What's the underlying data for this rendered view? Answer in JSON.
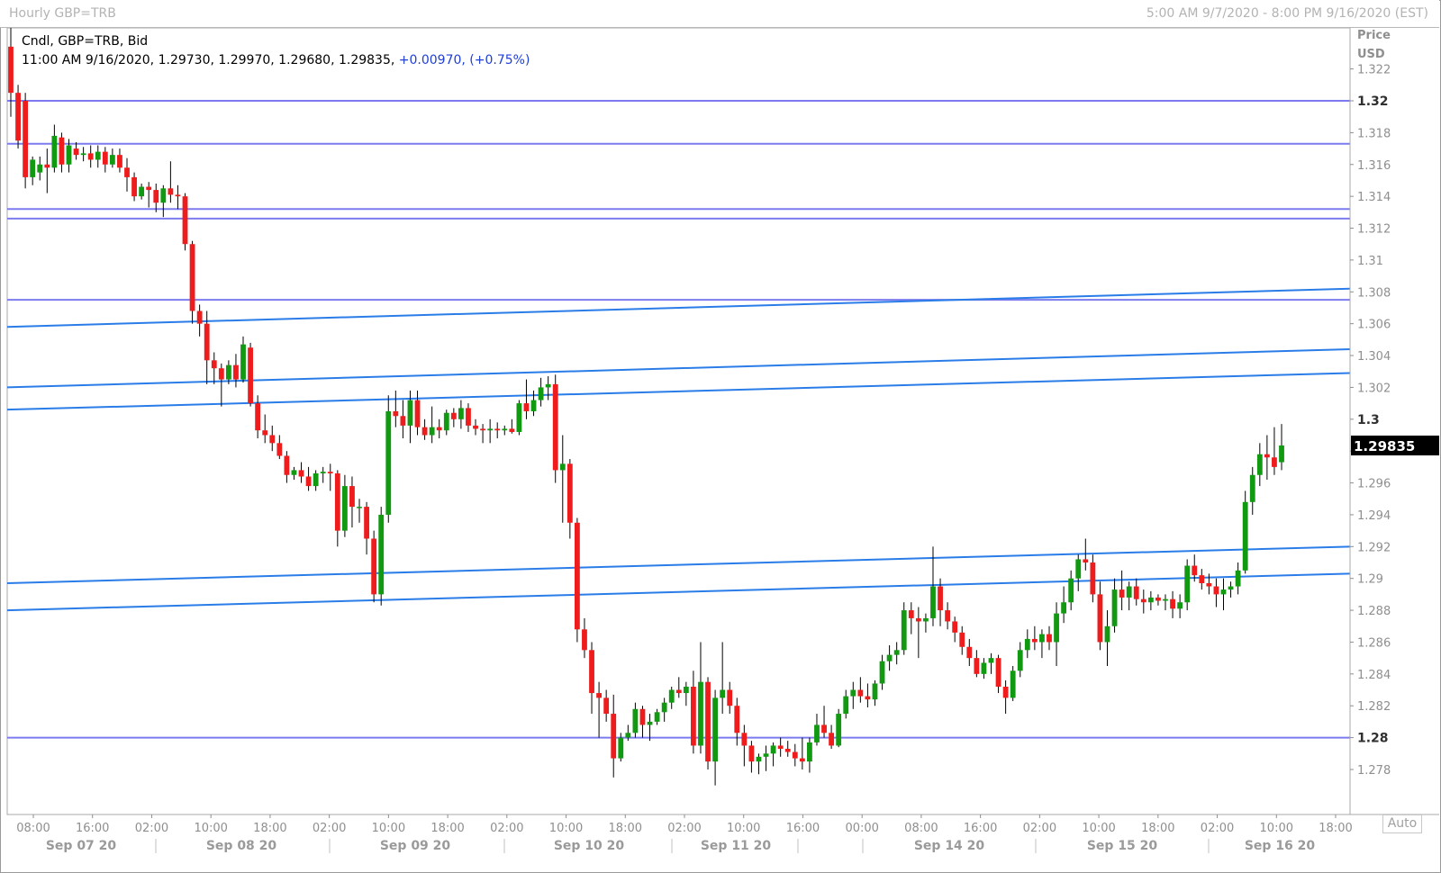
{
  "window": {
    "title": "Hourly GBP=TRB",
    "range": "5:00 AM 9/7/2020 - 8:00 PM 9/16/2020 (EST)"
  },
  "legend": {
    "line1": "Cndl, GBP=TRB, Bid",
    "line2": "11:00 AM 9/16/2020, 1.29730, 1.29970, 1.29680, 1.29835, ",
    "change": "+0.00970,",
    "change_pct": "(+0.75%)"
  },
  "axis": {
    "price_label": "Price",
    "currency_label": "USD",
    "current_price": "1.29835",
    "auto_label": "Auto"
  },
  "colors": {
    "up": "#119911",
    "down": "#ee1c1c",
    "horizontal_level": "#7b7bef",
    "trend_line": "#2a7de8",
    "price_box": "#000000"
  },
  "chart_data": {
    "type": "candlestick",
    "symbol": "GBP=TRB",
    "interval": "Hourly",
    "ylim": [
      1.2765,
      1.3245
    ],
    "y_ticks": [
      1.322,
      1.32,
      1.318,
      1.316,
      1.314,
      1.312,
      1.31,
      1.308,
      1.306,
      1.304,
      1.302,
      1.3,
      1.298,
      1.296,
      1.294,
      1.292,
      1.29,
      1.288,
      1.286,
      1.284,
      1.282,
      1.28,
      1.278
    ],
    "y_ticks_bold": [
      1.32,
      1.3,
      1.28
    ],
    "x_time_ticks": [
      "08:00",
      "16:00",
      "02:00",
      "10:00",
      "18:00",
      "02:00",
      "10:00",
      "18:00",
      "02:00",
      "10:00",
      "18:00",
      "02:00",
      "10:00",
      "16:00",
      "00:00",
      "08:00",
      "16:00",
      "02:00",
      "10:00",
      "18:00",
      "02:00",
      "10:00",
      "18:00"
    ],
    "x_date_labels": [
      "Sep 07 20",
      "Sep 08 20",
      "Sep 09 20",
      "Sep 10 20",
      "Sep 11 20",
      "Sep 14 20",
      "Sep 15 20",
      "Sep 16 20"
    ],
    "horizontal_levels": [
      1.32,
      1.3173,
      1.3132,
      1.3126,
      1.3075,
      1.28
    ],
    "trend_lines": [
      {
        "start": 1.3058,
        "end": 1.3082
      },
      {
        "start": 1.302,
        "end": 1.3044
      },
      {
        "start": 1.3006,
        "end": 1.3029
      },
      {
        "start": 1.2897,
        "end": 1.292
      },
      {
        "start": 1.288,
        "end": 1.2903
      }
    ],
    "last_close": 1.29835,
    "candles": [
      [
        1.3234,
        1.3248,
        1.319,
        1.3205
      ],
      [
        1.3205,
        1.321,
        1.317,
        1.3175
      ],
      [
        1.32,
        1.3205,
        1.3145,
        1.3152
      ],
      [
        1.3152,
        1.3165,
        1.3147,
        1.3163
      ],
      [
        1.3155,
        1.3165,
        1.315,
        1.316
      ],
      [
        1.316,
        1.317,
        1.3142,
        1.3158
      ],
      [
        1.3158,
        1.3185,
        1.3155,
        1.3178
      ],
      [
        1.3177,
        1.318,
        1.3155,
        1.316
      ],
      [
        1.316,
        1.3176,
        1.3155,
        1.3172
      ],
      [
        1.317,
        1.3174,
        1.3163,
        1.3166
      ],
      [
        1.3166,
        1.3171,
        1.3162,
        1.3167
      ],
      [
        1.3167,
        1.3172,
        1.3158,
        1.3163
      ],
      [
        1.3163,
        1.3172,
        1.3158,
        1.3168
      ],
      [
        1.3168,
        1.3171,
        1.3155,
        1.316
      ],
      [
        1.316,
        1.317,
        1.3158,
        1.3166
      ],
      [
        1.3166,
        1.317,
        1.3155,
        1.3158
      ],
      [
        1.3158,
        1.3164,
        1.3143,
        1.3152
      ],
      [
        1.3152,
        1.3155,
        1.3137,
        1.314
      ],
      [
        1.314,
        1.3148,
        1.3138,
        1.3146
      ],
      [
        1.3146,
        1.3149,
        1.3133,
        1.3144
      ],
      [
        1.3144,
        1.3148,
        1.313,
        1.3136
      ],
      [
        1.3136,
        1.3147,
        1.3127,
        1.3145
      ],
      [
        1.3145,
        1.3162,
        1.3136,
        1.3141
      ],
      [
        1.3141,
        1.3147,
        1.3132,
        1.314
      ],
      [
        1.314,
        1.3142,
        1.3106,
        1.311
      ],
      [
        1.311,
        1.3112,
        1.306,
        1.3068
      ],
      [
        1.3068,
        1.3072,
        1.3052,
        1.306
      ],
      [
        1.306,
        1.3068,
        1.3022,
        1.3037
      ],
      [
        1.3037,
        1.3042,
        1.3022,
        1.3032
      ],
      [
        1.3032,
        1.3035,
        1.3008,
        1.3025
      ],
      [
        1.3025,
        1.3037,
        1.3022,
        1.3034
      ],
      [
        1.3034,
        1.3041,
        1.302,
        1.3025
      ],
      [
        1.3025,
        1.3052,
        1.3023,
        1.3047
      ],
      [
        1.3045,
        1.3048,
        1.3008,
        1.301
      ],
      [
        1.301,
        1.3015,
        1.2988,
        1.2993
      ],
      [
        1.2993,
        1.3003,
        1.2985,
        1.299
      ],
      [
        1.299,
        1.2996,
        1.298,
        1.2985
      ],
      [
        1.2985,
        1.299,
        1.2975,
        1.2977
      ],
      [
        1.2977,
        1.298,
        1.296,
        1.2965
      ],
      [
        1.2965,
        1.297,
        1.2962,
        1.2968
      ],
      [
        1.2968,
        1.2973,
        1.296,
        1.2964
      ],
      [
        1.2964,
        1.297,
        1.2955,
        1.2958
      ],
      [
        1.2958,
        1.2968,
        1.2955,
        1.2966
      ],
      [
        1.2966,
        1.297,
        1.296,
        1.2967
      ],
      [
        1.2967,
        1.2972,
        1.2955,
        1.2966
      ],
      [
        1.2966,
        1.2968,
        1.292,
        1.293
      ],
      [
        1.293,
        1.2965,
        1.2926,
        1.2958
      ],
      [
        1.2958,
        1.2964,
        1.2932,
        1.2945
      ],
      [
        1.2945,
        1.295,
        1.2935,
        1.2945
      ],
      [
        1.2945,
        1.2948,
        1.2915,
        1.2925
      ],
      [
        1.2925,
        1.293,
        1.2885,
        1.289
      ],
      [
        1.289,
        1.2945,
        1.2883,
        1.294
      ],
      [
        1.294,
        1.3015,
        1.2935,
        1.3005
      ],
      [
        1.3005,
        1.3018,
        1.2995,
        1.3002
      ],
      [
        1.3002,
        1.3012,
        1.2988,
        1.2996
      ],
      [
        1.2996,
        1.3018,
        1.2985,
        1.3012
      ],
      [
        1.3012,
        1.3018,
        1.299,
        1.2995
      ],
      [
        1.2995,
        1.3,
        1.2987,
        1.299
      ],
      [
        1.299,
        1.3008,
        1.2985,
        1.2995
      ],
      [
        1.2995,
        1.3,
        1.2988,
        1.2993
      ],
      [
        1.2993,
        1.3006,
        1.299,
        1.3004
      ],
      [
        1.3004,
        1.3007,
        1.2995,
        1.3
      ],
      [
        1.3,
        1.3012,
        1.2994,
        1.3007
      ],
      [
        1.3007,
        1.301,
        1.2992,
        1.2996
      ],
      [
        1.2996,
        1.3,
        1.299,
        1.2994
      ],
      [
        1.2994,
        1.2997,
        1.2985,
        1.2993
      ],
      [
        1.2993,
        1.3,
        1.2985,
        1.2994
      ],
      [
        1.2994,
        1.2998,
        1.2988,
        1.2993
      ],
      [
        1.2993,
        1.2996,
        1.299,
        1.2994
      ],
      [
        1.2994,
        1.3,
        1.2991,
        1.2992
      ],
      [
        1.2992,
        1.3012,
        1.299,
        1.301
      ],
      [
        1.301,
        1.3025,
        1.3,
        1.3005
      ],
      [
        1.3005,
        1.3018,
        1.3002,
        1.3012
      ],
      [
        1.3012,
        1.3026,
        1.3008,
        1.302
      ],
      [
        1.302,
        1.3027,
        1.3012,
        1.3022
      ],
      [
        1.3022,
        1.3028,
        1.296,
        1.2968
      ],
      [
        1.2968,
        1.299,
        1.2935,
        1.2972
      ],
      [
        1.2972,
        1.2975,
        1.2925,
        1.2935
      ],
      [
        1.2935,
        1.2938,
        1.286,
        1.2868
      ],
      [
        1.2868,
        1.2875,
        1.285,
        1.2855
      ],
      [
        1.2855,
        1.286,
        1.2815,
        1.2828
      ],
      [
        1.2828,
        1.2835,
        1.28,
        1.2825
      ],
      [
        1.2825,
        1.283,
        1.281,
        1.2815
      ],
      [
        1.2815,
        1.2827,
        1.2775,
        1.2787
      ],
      [
        1.2787,
        1.2803,
        1.2785,
        1.28
      ],
      [
        1.28,
        1.2808,
        1.2798,
        1.2803
      ],
      [
        1.2803,
        1.2822,
        1.28,
        1.2818
      ],
      [
        1.2818,
        1.282,
        1.28,
        1.2808
      ],
      [
        1.2808,
        1.2815,
        1.2798,
        1.281
      ],
      [
        1.281,
        1.2818,
        1.2808,
        1.2816
      ],
      [
        1.2816,
        1.2825,
        1.281,
        1.2822
      ],
      [
        1.2822,
        1.2832,
        1.2818,
        1.283
      ],
      [
        1.283,
        1.2838,
        1.2825,
        1.2828
      ],
      [
        1.2828,
        1.2835,
        1.282,
        1.2832
      ],
      [
        1.2832,
        1.2842,
        1.279,
        1.2795
      ],
      [
        1.2795,
        1.286,
        1.279,
        1.2835
      ],
      [
        1.2835,
        1.2838,
        1.278,
        1.2785
      ],
      [
        1.2785,
        1.283,
        1.277,
        1.2825
      ],
      [
        1.2825,
        1.286,
        1.2815,
        1.283
      ],
      [
        1.283,
        1.2835,
        1.2815,
        1.282
      ],
      [
        1.282,
        1.2825,
        1.2795,
        1.2803
      ],
      [
        1.2803,
        1.2808,
        1.2782,
        1.2795
      ],
      [
        1.2795,
        1.2798,
        1.2778,
        1.2785
      ],
      [
        1.2785,
        1.279,
        1.2777,
        1.2788
      ],
      [
        1.2788,
        1.2795,
        1.2779,
        1.279
      ],
      [
        1.279,
        1.2797,
        1.2782,
        1.2795
      ],
      [
        1.2795,
        1.28,
        1.2788,
        1.2793
      ],
      [
        1.2793,
        1.2798,
        1.2788,
        1.2791
      ],
      [
        1.2791,
        1.2796,
        1.2782,
        1.2787
      ],
      [
        1.2787,
        1.28,
        1.278,
        1.2785
      ],
      [
        1.2785,
        1.28,
        1.2778,
        1.2797
      ],
      [
        1.2797,
        1.2815,
        1.2795,
        1.2808
      ],
      [
        1.2808,
        1.282,
        1.28,
        1.2803
      ],
      [
        1.2803,
        1.2808,
        1.2793,
        1.2795
      ],
      [
        1.2795,
        1.2818,
        1.2794,
        1.2815
      ],
      [
        1.2815,
        1.283,
        1.2812,
        1.2826
      ],
      [
        1.2826,
        1.2835,
        1.2818,
        1.283
      ],
      [
        1.283,
        1.2838,
        1.2822,
        1.2826
      ],
      [
        1.2826,
        1.2834,
        1.2819,
        1.2824
      ],
      [
        1.2824,
        1.2836,
        1.282,
        1.2834
      ],
      [
        1.2834,
        1.2852,
        1.283,
        1.2848
      ],
      [
        1.2848,
        1.2858,
        1.2842,
        1.2852
      ],
      [
        1.2852,
        1.286,
        1.2846,
        1.2855
      ],
      [
        1.2855,
        1.2885,
        1.2852,
        1.288
      ],
      [
        1.288,
        1.2885,
        1.2865,
        1.2875
      ],
      [
        1.2875,
        1.2882,
        1.285,
        1.2873
      ],
      [
        1.2873,
        1.2878,
        1.2866,
        1.2875
      ],
      [
        1.2875,
        1.292,
        1.287,
        1.2895
      ],
      [
        1.2895,
        1.29,
        1.287,
        1.288
      ],
      [
        1.288,
        1.2885,
        1.2868,
        1.2873
      ],
      [
        1.2873,
        1.2876,
        1.286,
        1.2866
      ],
      [
        1.2866,
        1.287,
        1.2852,
        1.2857
      ],
      [
        1.2857,
        1.2862,
        1.2845,
        1.285
      ],
      [
        1.285,
        1.2855,
        1.2838,
        1.284
      ],
      [
        1.284,
        1.285,
        1.2837,
        1.2847
      ],
      [
        1.2847,
        1.2853,
        1.284,
        1.285
      ],
      [
        1.285,
        1.2852,
        1.2828,
        1.2832
      ],
      [
        1.2832,
        1.2836,
        1.2815,
        1.2825
      ],
      [
        1.2825,
        1.2845,
        1.2823,
        1.2842
      ],
      [
        1.2842,
        1.286,
        1.2838,
        1.2855
      ],
      [
        1.2855,
        1.2868,
        1.285,
        1.2862
      ],
      [
        1.2862,
        1.287,
        1.2855,
        1.286
      ],
      [
        1.286,
        1.2868,
        1.285,
        1.2865
      ],
      [
        1.2865,
        1.287,
        1.2855,
        1.286
      ],
      [
        1.286,
        1.2885,
        1.2845,
        1.2878
      ],
      [
        1.2878,
        1.2895,
        1.2872,
        1.2885
      ],
      [
        1.2885,
        1.2905,
        1.288,
        1.29
      ],
      [
        1.29,
        1.2915,
        1.2892,
        1.2912
      ],
      [
        1.2912,
        1.2925,
        1.2905,
        1.291
      ],
      [
        1.291,
        1.2915,
        1.2885,
        1.289
      ],
      [
        1.289,
        1.2898,
        1.2855,
        1.286
      ],
      [
        1.286,
        1.288,
        1.2845,
        1.287
      ],
      [
        1.287,
        1.29,
        1.2866,
        1.2893
      ],
      [
        1.2893,
        1.2905,
        1.288,
        1.2888
      ],
      [
        1.2888,
        1.2898,
        1.288,
        1.2895
      ],
      [
        1.2895,
        1.29,
        1.2883,
        1.2887
      ],
      [
        1.2887,
        1.2893,
        1.2878,
        1.2885
      ],
      [
        1.2885,
        1.2892,
        1.288,
        1.2888
      ],
      [
        1.2888,
        1.289,
        1.2883,
        1.2886
      ],
      [
        1.2886,
        1.289,
        1.288,
        1.2887
      ],
      [
        1.2887,
        1.2892,
        1.2875,
        1.2881
      ],
      [
        1.2881,
        1.289,
        1.2875,
        1.2885
      ],
      [
        1.2885,
        1.2912,
        1.288,
        1.2908
      ],
      [
        1.2908,
        1.2915,
        1.2898,
        1.2902
      ],
      [
        1.2902,
        1.2906,
        1.2893,
        1.2897
      ],
      [
        1.2897,
        1.2903,
        1.289,
        1.2895
      ],
      [
        1.2895,
        1.29,
        1.2882,
        1.289
      ],
      [
        1.289,
        1.29,
        1.288,
        1.2893
      ],
      [
        1.2893,
        1.2898,
        1.2888,
        1.2895
      ],
      [
        1.2895,
        1.291,
        1.289,
        1.2905
      ],
      [
        1.2905,
        1.2955,
        1.2903,
        1.2948
      ],
      [
        1.2948,
        1.297,
        1.294,
        1.2965
      ],
      [
        1.2965,
        1.2985,
        1.2958,
        1.2978
      ],
      [
        1.2978,
        1.299,
        1.2962,
        1.2976
      ],
      [
        1.2976,
        1.2995,
        1.2965,
        1.297
      ],
      [
        1.2973,
        1.2997,
        1.2968,
        1.29835
      ]
    ]
  }
}
